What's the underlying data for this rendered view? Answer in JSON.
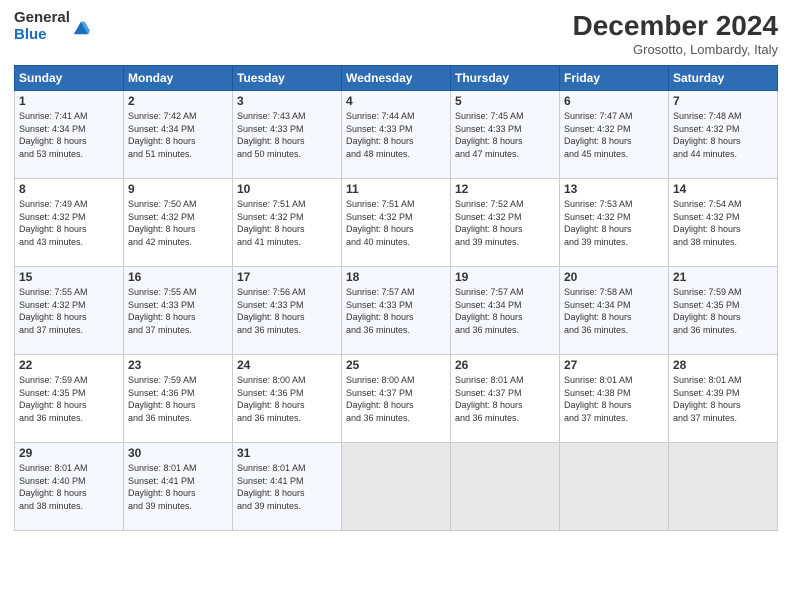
{
  "logo": {
    "general": "General",
    "blue": "Blue"
  },
  "title": "December 2024",
  "location": "Grosotto, Lombardy, Italy",
  "headers": [
    "Sunday",
    "Monday",
    "Tuesday",
    "Wednesday",
    "Thursday",
    "Friday",
    "Saturday"
  ],
  "rows": [
    [
      {
        "day": "1",
        "info": "Sunrise: 7:41 AM\nSunset: 4:34 PM\nDaylight: 8 hours\nand 53 minutes."
      },
      {
        "day": "2",
        "info": "Sunrise: 7:42 AM\nSunset: 4:34 PM\nDaylight: 8 hours\nand 51 minutes."
      },
      {
        "day": "3",
        "info": "Sunrise: 7:43 AM\nSunset: 4:33 PM\nDaylight: 8 hours\nand 50 minutes."
      },
      {
        "day": "4",
        "info": "Sunrise: 7:44 AM\nSunset: 4:33 PM\nDaylight: 8 hours\nand 48 minutes."
      },
      {
        "day": "5",
        "info": "Sunrise: 7:45 AM\nSunset: 4:33 PM\nDaylight: 8 hours\nand 47 minutes."
      },
      {
        "day": "6",
        "info": "Sunrise: 7:47 AM\nSunset: 4:32 PM\nDaylight: 8 hours\nand 45 minutes."
      },
      {
        "day": "7",
        "info": "Sunrise: 7:48 AM\nSunset: 4:32 PM\nDaylight: 8 hours\nand 44 minutes."
      }
    ],
    [
      {
        "day": "8",
        "info": "Sunrise: 7:49 AM\nSunset: 4:32 PM\nDaylight: 8 hours\nand 43 minutes."
      },
      {
        "day": "9",
        "info": "Sunrise: 7:50 AM\nSunset: 4:32 PM\nDaylight: 8 hours\nand 42 minutes."
      },
      {
        "day": "10",
        "info": "Sunrise: 7:51 AM\nSunset: 4:32 PM\nDaylight: 8 hours\nand 41 minutes."
      },
      {
        "day": "11",
        "info": "Sunrise: 7:51 AM\nSunset: 4:32 PM\nDaylight: 8 hours\nand 40 minutes."
      },
      {
        "day": "12",
        "info": "Sunrise: 7:52 AM\nSunset: 4:32 PM\nDaylight: 8 hours\nand 39 minutes."
      },
      {
        "day": "13",
        "info": "Sunrise: 7:53 AM\nSunset: 4:32 PM\nDaylight: 8 hours\nand 39 minutes."
      },
      {
        "day": "14",
        "info": "Sunrise: 7:54 AM\nSunset: 4:32 PM\nDaylight: 8 hours\nand 38 minutes."
      }
    ],
    [
      {
        "day": "15",
        "info": "Sunrise: 7:55 AM\nSunset: 4:32 PM\nDaylight: 8 hours\nand 37 minutes."
      },
      {
        "day": "16",
        "info": "Sunrise: 7:55 AM\nSunset: 4:33 PM\nDaylight: 8 hours\nand 37 minutes."
      },
      {
        "day": "17",
        "info": "Sunrise: 7:56 AM\nSunset: 4:33 PM\nDaylight: 8 hours\nand 36 minutes."
      },
      {
        "day": "18",
        "info": "Sunrise: 7:57 AM\nSunset: 4:33 PM\nDaylight: 8 hours\nand 36 minutes."
      },
      {
        "day": "19",
        "info": "Sunrise: 7:57 AM\nSunset: 4:34 PM\nDaylight: 8 hours\nand 36 minutes."
      },
      {
        "day": "20",
        "info": "Sunrise: 7:58 AM\nSunset: 4:34 PM\nDaylight: 8 hours\nand 36 minutes."
      },
      {
        "day": "21",
        "info": "Sunrise: 7:59 AM\nSunset: 4:35 PM\nDaylight: 8 hours\nand 36 minutes."
      }
    ],
    [
      {
        "day": "22",
        "info": "Sunrise: 7:59 AM\nSunset: 4:35 PM\nDaylight: 8 hours\nand 36 minutes."
      },
      {
        "day": "23",
        "info": "Sunrise: 7:59 AM\nSunset: 4:36 PM\nDaylight: 8 hours\nand 36 minutes."
      },
      {
        "day": "24",
        "info": "Sunrise: 8:00 AM\nSunset: 4:36 PM\nDaylight: 8 hours\nand 36 minutes."
      },
      {
        "day": "25",
        "info": "Sunrise: 8:00 AM\nSunset: 4:37 PM\nDaylight: 8 hours\nand 36 minutes."
      },
      {
        "day": "26",
        "info": "Sunrise: 8:01 AM\nSunset: 4:37 PM\nDaylight: 8 hours\nand 36 minutes."
      },
      {
        "day": "27",
        "info": "Sunrise: 8:01 AM\nSunset: 4:38 PM\nDaylight: 8 hours\nand 37 minutes."
      },
      {
        "day": "28",
        "info": "Sunrise: 8:01 AM\nSunset: 4:39 PM\nDaylight: 8 hours\nand 37 minutes."
      }
    ],
    [
      {
        "day": "29",
        "info": "Sunrise: 8:01 AM\nSunset: 4:40 PM\nDaylight: 8 hours\nand 38 minutes."
      },
      {
        "day": "30",
        "info": "Sunrise: 8:01 AM\nSunset: 4:41 PM\nDaylight: 8 hours\nand 39 minutes."
      },
      {
        "day": "31",
        "info": "Sunrise: 8:01 AM\nSunset: 4:41 PM\nDaylight: 8 hours\nand 39 minutes."
      },
      {
        "day": "",
        "info": ""
      },
      {
        "day": "",
        "info": ""
      },
      {
        "day": "",
        "info": ""
      },
      {
        "day": "",
        "info": ""
      }
    ]
  ]
}
